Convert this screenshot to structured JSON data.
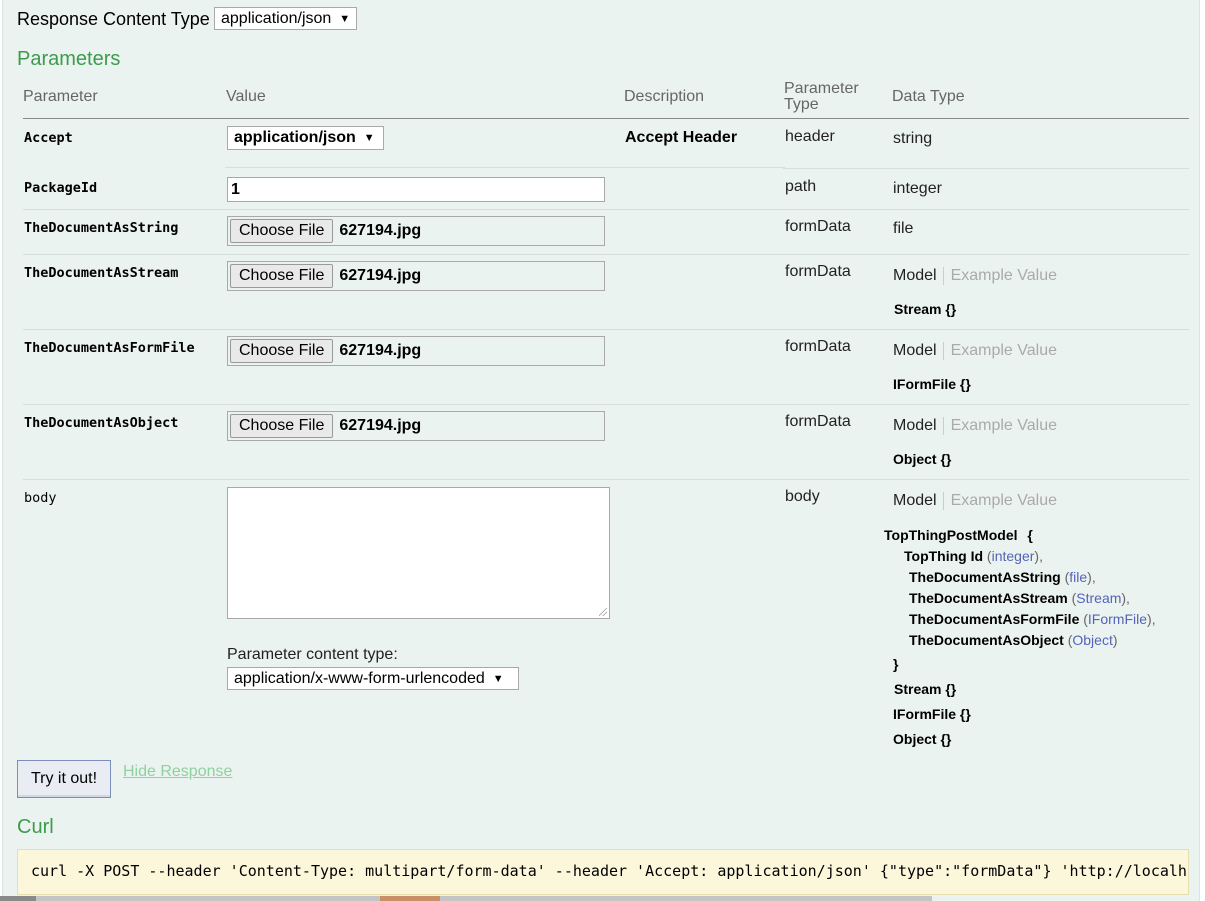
{
  "response_content_type": {
    "label": "Response Content Type",
    "selected": "application/json"
  },
  "parameters_title": "Parameters",
  "table_headers": {
    "parameter": "Parameter",
    "value": "Value",
    "description": "Description",
    "parameter_type_line1": "Parameter",
    "parameter_type_line2": "Type",
    "data_type": "Data Type"
  },
  "rows": {
    "accept": {
      "name": "Accept",
      "value": "application/json",
      "description": "Accept Header",
      "param_type": "header",
      "data_type": "string"
    },
    "package_id": {
      "name": "PackageId",
      "value": "1",
      "param_type": "path",
      "data_type": "integer"
    },
    "doc_string": {
      "name": "TheDocumentAsString",
      "button": "Choose File",
      "file": "627194.jpg",
      "param_type": "formData",
      "data_type": "file"
    },
    "doc_stream": {
      "name": "TheDocumentAsStream",
      "button": "Choose File",
      "file": "627194.jpg",
      "param_type": "formData",
      "model_tab": "Model",
      "example_tab": "Example Value",
      "schema": "Stream {}"
    },
    "doc_formfile": {
      "name": "TheDocumentAsFormFile",
      "button": "Choose File",
      "file": "627194.jpg",
      "param_type": "formData",
      "model_tab": "Model",
      "example_tab": "Example Value",
      "schema": "IFormFile {}"
    },
    "doc_object": {
      "name": "TheDocumentAsObject",
      "button": "Choose File",
      "file": "627194.jpg",
      "param_type": "formData",
      "model_tab": "Model",
      "example_tab": "Example Value",
      "schema": "Object {}"
    },
    "body": {
      "name": "body",
      "value": "",
      "param_type": "body",
      "content_type_label": "Parameter content type:",
      "content_type_selected": "application/x-www-form-urlencoded",
      "model_tab": "Model",
      "example_tab": "Example Value",
      "model": {
        "name": "TopThingPostModel",
        "open_brace": "{",
        "close_brace": "}",
        "props": [
          {
            "name": "TopThing Id",
            "open": " (",
            "type": "integer",
            "close": "),"
          },
          {
            "name": "TheDocumentAsString",
            "open": " (",
            "type": "file",
            "close": "),"
          },
          {
            "name": "TheDocumentAsStream",
            "open": " (",
            "type": "Stream",
            "close": "),"
          },
          {
            "name": "TheDocumentAsFormFile",
            "open": " (",
            "type": "IFormFile",
            "close": "),"
          },
          {
            "name": "TheDocumentAsObject",
            "open": " (",
            "type": "Object",
            "close": ")"
          }
        ],
        "extra": [
          "Stream {}",
          "IFormFile {}",
          "Object {}"
        ]
      }
    }
  },
  "try_button": "Try it out!",
  "hide_response": "Hide Response",
  "curl_title": "Curl",
  "curl_command": "curl -X POST --header 'Content-Type: multipart/form-data' --header 'Accept: application/json' {\"type\":\"formData\"} 'http://localhos",
  "colors": {
    "panel_bg": "#ebf3f0",
    "section_title": "#3c9c4c",
    "link": "#8fd19e",
    "type_link": "#5563b8",
    "curl_bg": "#fcf6db"
  }
}
